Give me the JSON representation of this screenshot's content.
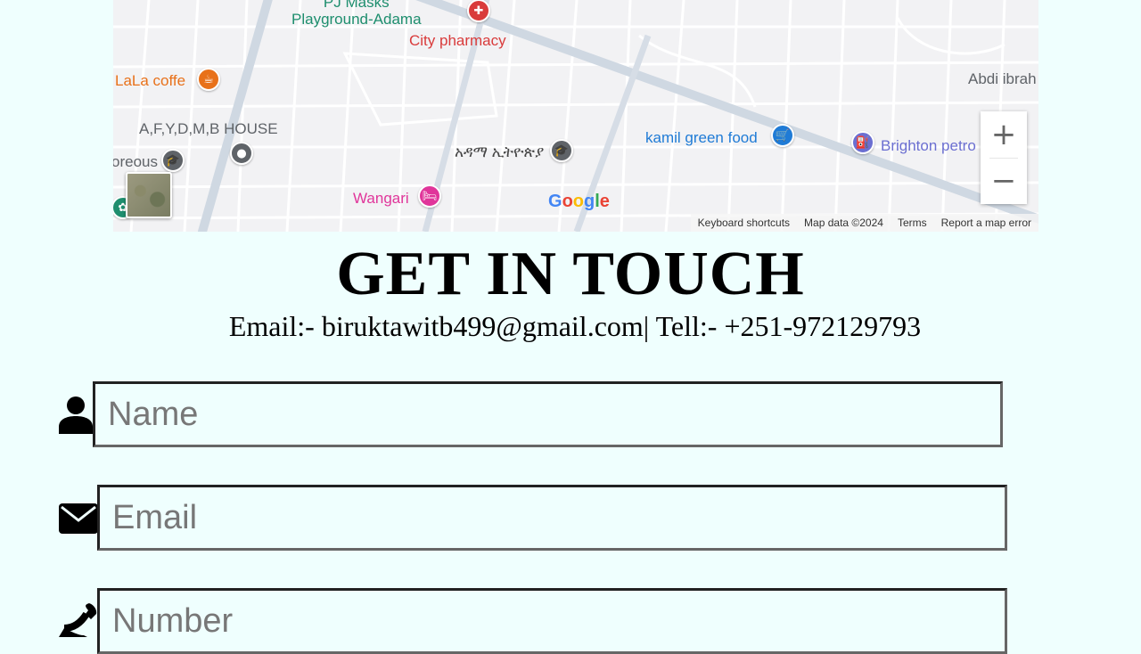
{
  "map": {
    "pois": {
      "pj_masks": "PJ Masks\nPlayground-Adama",
      "pj_masks_line1": "PJ Masks",
      "pj_masks_line2": "Playground-Adama",
      "city_pharmacy": "City pharmacy",
      "lala_coffe": "LaLa coffe",
      "afydmb_house": "A,F,Y,D,M,B HOUSE",
      "preous": "oreous",
      "adama_ethiopia": "አዳማ ኢትዮጵያ",
      "wangari": "Wangari",
      "kamil_green_food": "kamil green food",
      "brighton_petro": "Brighton petro",
      "abdi_ibrah": "Abdi ibrah"
    },
    "zoom_in_label": "+",
    "zoom_out_label": "−",
    "google_logo": "Google",
    "attribution": {
      "keyboard": "Keyboard shortcuts",
      "map_data": "Map data ©2024",
      "terms": "Terms",
      "report": "Report a map error"
    },
    "colors": {
      "green_poi": "#1e8e6e",
      "red_poi": "#d93b3b",
      "orange_poi": "#e8711a",
      "gray_poi": "#5f6368",
      "pink_poi": "#e0359a",
      "blue_poi": "#1f7bd6",
      "violet_poi": "#6b6fd1"
    }
  },
  "contact": {
    "title": "GET IN TOUCH",
    "line": "Email:- biruktawitb499@gmail.com| Tell:- +251-972129793"
  },
  "form": {
    "name_placeholder": "Name",
    "email_placeholder": "Email",
    "number_placeholder": "Number",
    "icons": [
      "user-icon",
      "envelope-icon",
      "phone-icon"
    ]
  }
}
